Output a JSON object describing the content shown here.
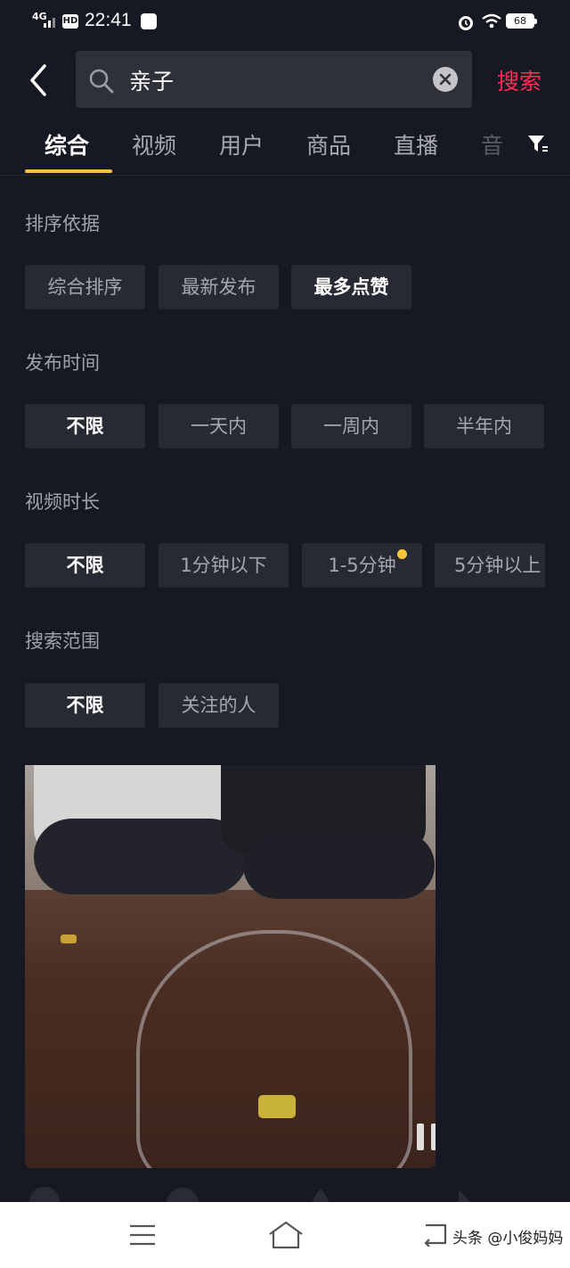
{
  "status_bar": {
    "network": "4G",
    "hd": "HD",
    "time": "22:41",
    "battery": "68"
  },
  "search": {
    "query": "亲子",
    "button_label": "搜索"
  },
  "tabs": [
    {
      "label": "综合",
      "active": true
    },
    {
      "label": "视频"
    },
    {
      "label": "用户"
    },
    {
      "label": "商品"
    },
    {
      "label": "直播"
    },
    {
      "label": "音"
    }
  ],
  "filters": {
    "sort": {
      "title": "排序依据",
      "options": [
        "综合排序",
        "最新发布",
        "最多点赞"
      ],
      "selected": "最多点赞"
    },
    "publish_time": {
      "title": "发布时间",
      "options": [
        "不限",
        "一天内",
        "一周内",
        "半年内"
      ],
      "selected": "不限"
    },
    "video_length": {
      "title": "视频时长",
      "options": [
        "不限",
        "1分钟以下",
        "1-5分钟",
        "5分钟以上"
      ],
      "selected": "不限"
    },
    "scope": {
      "title": "搜索范围",
      "options": [
        "不限",
        "关注的人"
      ],
      "selected": "不限"
    }
  },
  "accent_colors": {
    "search": "#fe2c55",
    "indicator": "#f6c43a"
  },
  "watermark": "头条 @小俊妈妈"
}
